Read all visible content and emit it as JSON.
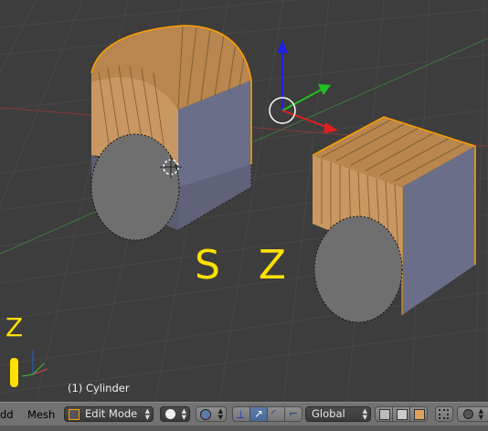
{
  "viewport": {
    "object_label": "(1) Cylinder",
    "overlay_keys": "S Z",
    "axis_hint_letter": "Z"
  },
  "header": {
    "add_menu_partial": "dd",
    "mesh_menu": "Mesh",
    "mode_select": "Edit Mode",
    "orientation_select": "Global"
  },
  "colors": {
    "viewport_bg": "#3d3d3d",
    "selection": "#ffa000",
    "overlay_text": "#ffe000",
    "x_axis": "#e02020",
    "y_axis": "#20c020",
    "z_axis": "#2020e0"
  }
}
